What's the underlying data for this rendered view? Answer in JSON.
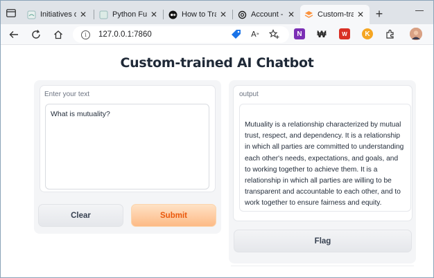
{
  "browser": {
    "tabs": [
      {
        "title": "Initiatives on",
        "active": false,
        "favicon": "page-icon"
      },
      {
        "title": "Python Func",
        "active": false,
        "favicon": "page-icon"
      },
      {
        "title": "How to Train",
        "active": false,
        "favicon": "medium-icon"
      },
      {
        "title": "Account - Op",
        "active": false,
        "favicon": "openai-icon"
      },
      {
        "title": "Custom-train",
        "active": true,
        "favicon": "gradio-icon"
      }
    ],
    "url": "127.0.0.1:7860"
  },
  "app": {
    "title": "Custom-trained AI Chatbot",
    "input_label": "Enter your text",
    "input_value": "What is mutuality?",
    "clear_label": "Clear",
    "submit_label": "Submit",
    "output_label": "output",
    "output_value": "Mutuality is a relationship characterized by mutual trust, respect, and dependency. It is a relationship in which all parties are committed to understanding each other's needs, expectations, and goals, and to working together to achieve them. It is a relationship in which all parties are willing to be transparent and accountable to each other, and to work together to ensure fairness and equity.",
    "flag_label": "Flag"
  },
  "colors": {
    "submit_text": "#ea580c",
    "submit_bg": "#fdba86",
    "secondary_bg": "#e5e7eb"
  }
}
